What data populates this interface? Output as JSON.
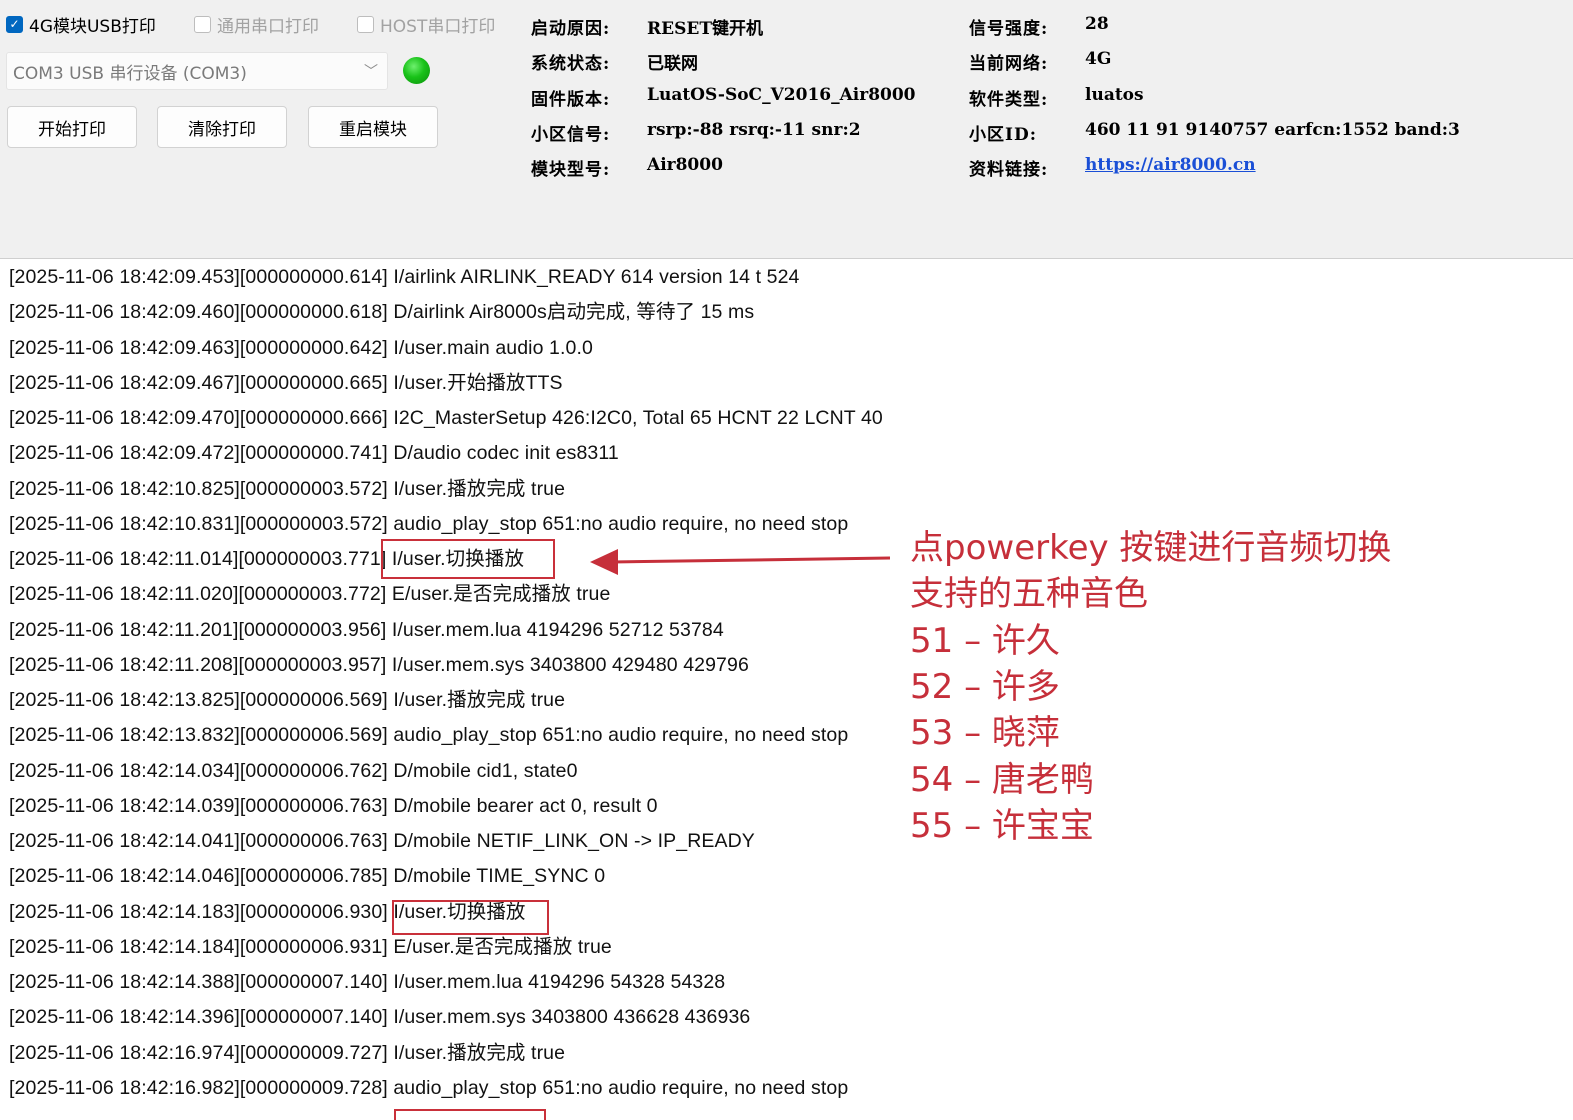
{
  "checkboxes": [
    {
      "label": "4G模块USB打印",
      "checked": true
    },
    {
      "label": "通用串口打印",
      "checked": false
    },
    {
      "label": "HOST串口打印",
      "checked": false
    }
  ],
  "port": {
    "selected": "COM3 USB 串行设备 (COM3)"
  },
  "status_led_color": "#19c219",
  "buttons": [
    "开始打印",
    "清除打印",
    "重启模块"
  ],
  "info_left": [
    {
      "label": "启动原因:",
      "value": "RESET键开机"
    },
    {
      "label": "系统状态:",
      "value": "已联网"
    },
    {
      "label": "固件版本:",
      "value": "LuatOS-SoC_V2016_Air8000"
    },
    {
      "label": "小区信号:",
      "value": "rsrp:-88 rsrq:-11 snr:2"
    },
    {
      "label": "模块型号:",
      "value": "Air8000"
    }
  ],
  "info_right": [
    {
      "label": "信号强度:",
      "value": "28"
    },
    {
      "label": "当前网络:",
      "value": "4G"
    },
    {
      "label": "软件类型:",
      "value": "luatos"
    },
    {
      "label": "小区ID:",
      "value": "460 11 91 9140757 earfcn:1552 band:3"
    },
    {
      "label": "资料链接:",
      "value": "https://air8000.cn"
    }
  ],
  "log_lines": [
    "[2025-11-06 18:42:09.453][000000000.614] I/airlink AIRLINK_READY 614 version 14 t 524",
    "[2025-11-06 18:42:09.460][000000000.618] D/airlink Air8000s启动完成, 等待了 15 ms",
    "[2025-11-06 18:42:09.463][000000000.642] I/user.main audio 1.0.0",
    "[2025-11-06 18:42:09.467][000000000.665] I/user.开始播放TTS",
    "[2025-11-06 18:42:09.470][000000000.666] I2C_MasterSetup 426:I2C0, Total 65 HCNT 22 LCNT 40",
    "[2025-11-06 18:42:09.472][000000000.741] D/audio codec init es8311",
    "[2025-11-06 18:42:10.825][000000003.572] I/user.播放完成 true",
    "[2025-11-06 18:42:10.831][000000003.572] audio_play_stop 651:no audio require, no need stop",
    "[2025-11-06 18:42:11.014][000000003.771] I/user.切换播放",
    "[2025-11-06 18:42:11.020][000000003.772] E/user.是否完成播放 true",
    "[2025-11-06 18:42:11.201][000000003.956] I/user.mem.lua 4194296 52712 53784",
    "[2025-11-06 18:42:11.208][000000003.957] I/user.mem.sys 3403800 429480 429796",
    "[2025-11-06 18:42:13.825][000000006.569] I/user.播放完成 true",
    "[2025-11-06 18:42:13.832][000000006.569] audio_play_stop 651:no audio require, no need stop",
    "[2025-11-06 18:42:14.034][000000006.762] D/mobile cid1, state0",
    "[2025-11-06 18:42:14.039][000000006.763] D/mobile bearer act 0, result 0",
    "[2025-11-06 18:42:14.041][000000006.763] D/mobile NETIF_LINK_ON -> IP_READY",
    "[2025-11-06 18:42:14.046][000000006.785] D/mobile TIME_SYNC 0",
    "[2025-11-06 18:42:14.183][000000006.930] I/user.切换播放",
    "[2025-11-06 18:42:14.184][000000006.931] E/user.是否完成播放 true",
    "[2025-11-06 18:42:14.388][000000007.140] I/user.mem.lua 4194296 54328 54328",
    "[2025-11-06 18:42:14.396][000000007.140] I/user.mem.sys 3403800 436628 436936",
    "[2025-11-06 18:42:16.974][000000009.727] I/user.播放完成 true",
    "[2025-11-06 18:42:16.982][000000009.728] audio_play_stop 651:no audio require, no need stop"
  ],
  "annotation": {
    "lines": [
      "点powerkey 按键进行音频切换",
      "支持的五种音色",
      "51 – 许久",
      "52 – 许多",
      "53 – 晓萍",
      "54 – 唐老鸭",
      "55 – 许宝宝"
    ],
    "color": "#c62f3a"
  }
}
